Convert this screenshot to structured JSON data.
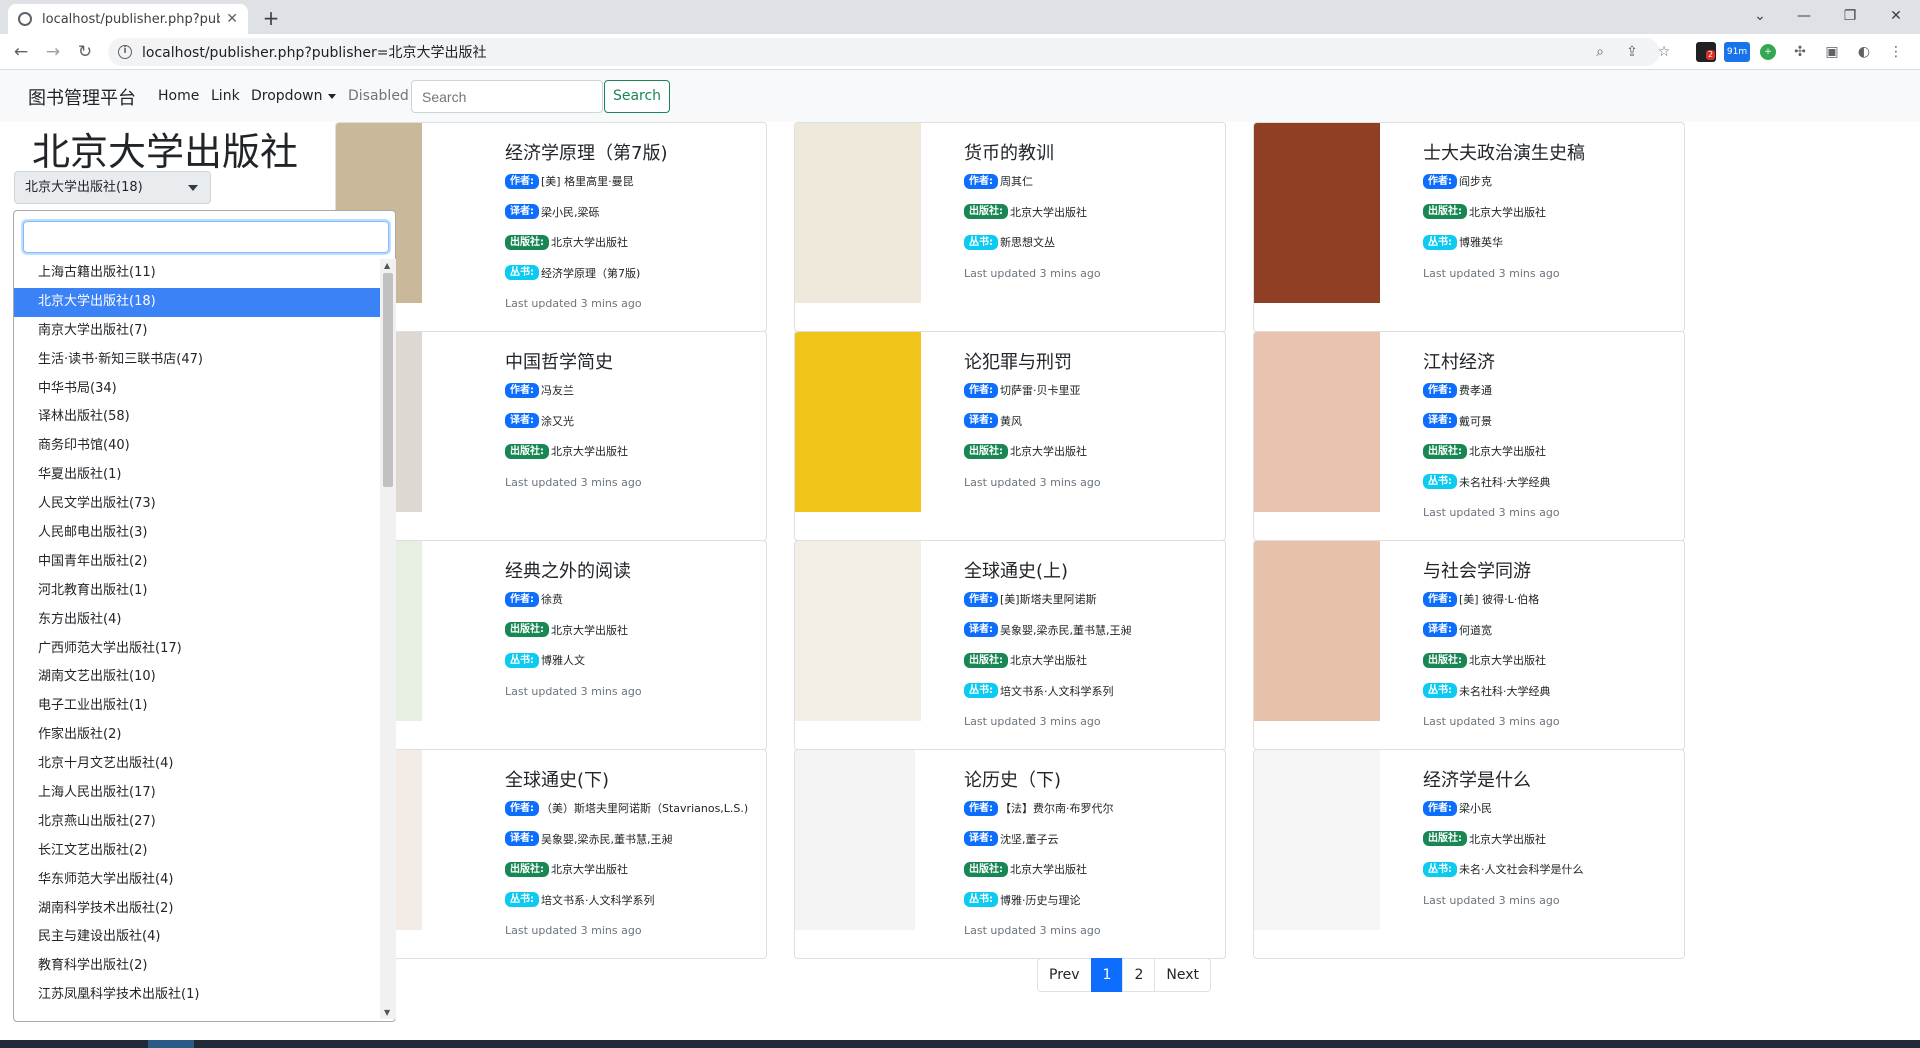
{
  "browser": {
    "tab_title": "localhost/publisher.php?publis",
    "tab_close": "✕",
    "new_tab": "+",
    "url": "localhost/publisher.php?publisher=北京大学出版社",
    "ext_badge_1": "2",
    "ext_badge_2": "91m"
  },
  "navbar": {
    "brand": "图书管理平台",
    "links": [
      "Home",
      "Link",
      "Dropdown",
      "Disabled"
    ],
    "search_placeholder": "Search",
    "search_button": "Search"
  },
  "page": {
    "title": "北京大学出版社"
  },
  "publisher_select": {
    "selected": "北京大学出版社(18)",
    "options": [
      "上海古籍出版社(11)",
      "北京大学出版社(18)",
      "南京大学出版社(7)",
      "生活·读书·新知三联书店(47)",
      "中华书局(34)",
      "译林出版社(58)",
      "商务印书馆(40)",
      "华夏出版社(1)",
      "人民文学出版社(73)",
      "人民邮电出版社(3)",
      "中国青年出版社(2)",
      "河北教育出版社(1)",
      "东方出版社(4)",
      "广西师范大学出版社(17)",
      "湖南文艺出版社(10)",
      "电子工业出版社(1)",
      "作家出版社(2)",
      "北京十月文艺出版社(4)",
      "上海人民出版社(17)",
      "北京燕山出版社(27)",
      "长江文艺出版社(2)",
      "华东师范大学出版社(4)",
      "湖南科学技术出版社(2)",
      "民主与建设出版社(4)",
      "教育科学出版社(2)",
      "江苏凤凰科学技术出版社(1)"
    ]
  },
  "labels": {
    "author": "作者:",
    "translator": "译者:",
    "publisher": "出版社:",
    "series": "丛书:"
  },
  "books": [
    {
      "title": "经济学原理（第7版)",
      "author": "[美] 格里高里·曼昆",
      "translator": "梁小民,梁砾",
      "publisher": "北京大学出版社",
      "series": "经济学原理（第7版)",
      "updated": "Last updated 3 mins ago"
    },
    {
      "title": "货币的教训",
      "author": "周其仁",
      "publisher": "北京大学出版社",
      "series": "新思想文丛",
      "updated": "Last updated 3 mins ago"
    },
    {
      "title": "士大夫政治演生史稿",
      "author": "阎步克",
      "publisher": "北京大学出版社",
      "series": "博雅英华",
      "updated": "Last updated 3 mins ago"
    },
    {
      "title": "中国哲学简史",
      "author": "冯友兰",
      "translator": "涂又光",
      "publisher": "北京大学出版社",
      "updated": "Last updated 3 mins ago"
    },
    {
      "title": "论犯罪与刑罚",
      "author": "切萨雷·贝卡里亚",
      "translator": "黄风",
      "publisher": "北京大学出版社",
      "updated": "Last updated 3 mins ago"
    },
    {
      "title": "江村经济",
      "author": "费孝通",
      "translator": "戴可景",
      "publisher": "北京大学出版社",
      "series": "未名社科·大学经典",
      "updated": "Last updated 3 mins ago"
    },
    {
      "title": "经典之外的阅读",
      "author": "徐贲",
      "publisher": "北京大学出版社",
      "series": "博雅人文",
      "updated": "Last updated 3 mins ago"
    },
    {
      "title": "全球通史(上)",
      "author": "[美]斯塔夫里阿诺斯",
      "translator": "吴象婴,梁赤民,董书慧,王昶",
      "publisher": "北京大学出版社",
      "series": "培文书系·人文科学系列",
      "updated": "Last updated 3 mins ago"
    },
    {
      "title": "与社会学同游",
      "author": "[美] 彼得·L·伯格",
      "translator": "何道宽",
      "publisher": "北京大学出版社",
      "series": "未名社科·大学经典",
      "updated": "Last updated 3 mins ago"
    },
    {
      "title": "全球通史(下)",
      "author": "（美）斯塔夫里阿诺斯（Stavrianos,L.S.)",
      "translator": "吴象婴,梁赤民,董书慧,王昶",
      "publisher": "北京大学出版社",
      "series": "培文书系·人文科学系列",
      "updated": "Last updated 3 mins ago"
    },
    {
      "title": "论历史（下)",
      "author": "【法】费尔南·布罗代尔",
      "translator": "沈坚,董子云",
      "publisher": "北京大学出版社",
      "series": "博雅·历史与理论",
      "updated": "Last updated 3 mins ago"
    },
    {
      "title": "经济学是什么",
      "author": "梁小民",
      "publisher": "北京大学出版社",
      "series": "未名·人文社会科学是什么",
      "updated": "Last updated 3 mins ago"
    }
  ],
  "pagination": {
    "prev": "Prev",
    "pages": [
      "1",
      "2"
    ],
    "next": "Next"
  },
  "colors": {
    "primary": "#0d6efd",
    "success": "#198754",
    "info": "#0dcaf0",
    "select_highlight": "#3b82f6"
  }
}
